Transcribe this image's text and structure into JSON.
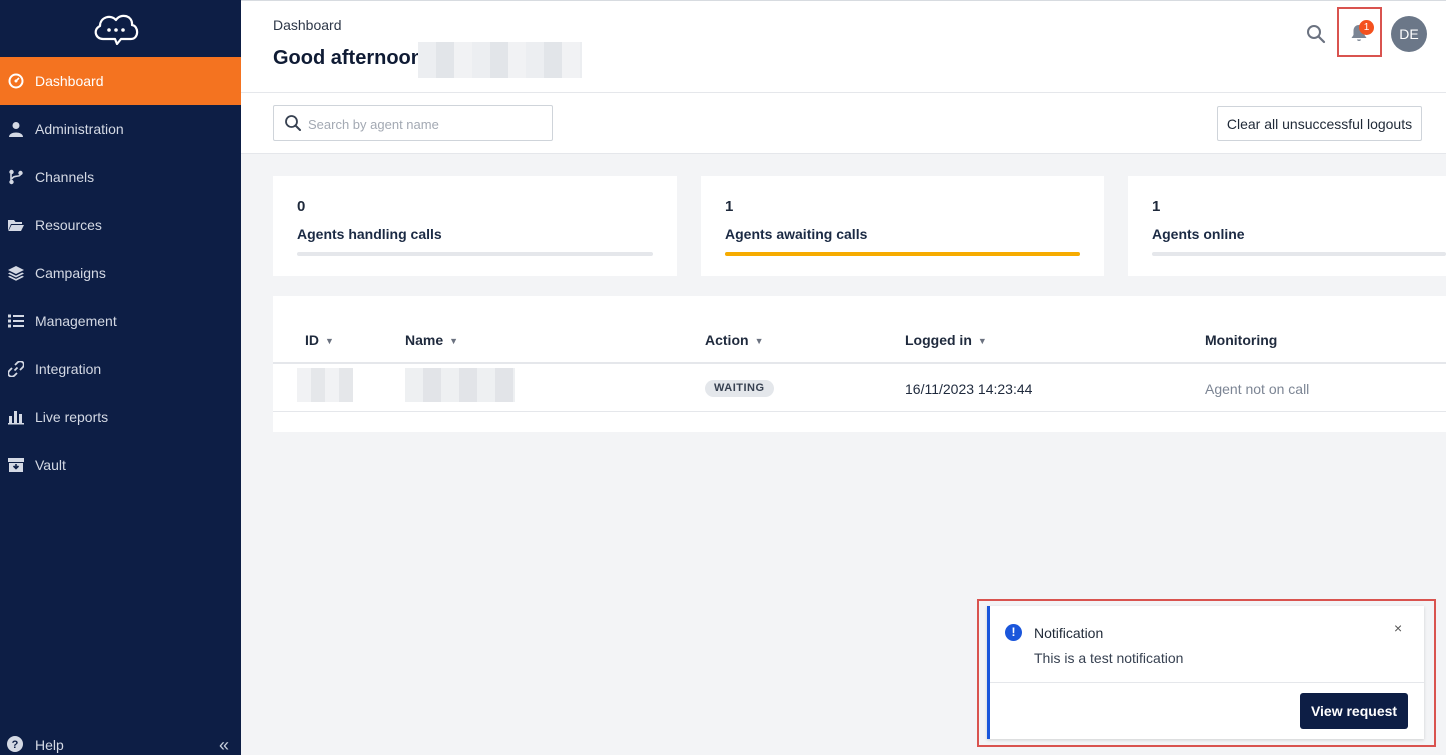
{
  "sidebar": {
    "items": [
      {
        "label": "Dashboard",
        "icon": "dashboard-gauge-icon",
        "active": true
      },
      {
        "label": "Administration",
        "icon": "user-icon"
      },
      {
        "label": "Channels",
        "icon": "branch-icon"
      },
      {
        "label": "Resources",
        "icon": "folder-icon"
      },
      {
        "label": "Campaigns",
        "icon": "layers-icon"
      },
      {
        "label": "Management",
        "icon": "list-icon"
      },
      {
        "label": "Integration",
        "icon": "link-icon"
      },
      {
        "label": "Live reports",
        "icon": "bar-chart-icon"
      },
      {
        "label": "Vault",
        "icon": "archive-icon"
      }
    ],
    "help_label": "Help",
    "collapse_glyph": "«"
  },
  "header": {
    "breadcrumb": "Dashboard",
    "greeting": "Good afternoon,",
    "notification_count": "1",
    "avatar_initials": "DE"
  },
  "toolbar": {
    "search_placeholder": "Search by agent name",
    "clear_button": "Clear all unsuccessful logouts"
  },
  "stats": [
    {
      "count": "0",
      "label": "Agents handling calls",
      "progress": 0
    },
    {
      "count": "1",
      "label": "Agents awaiting calls",
      "progress": 1
    },
    {
      "count": "1",
      "label": "Agents online",
      "progress": 0
    }
  ],
  "table": {
    "columns": [
      "ID",
      "Name",
      "Action",
      "Logged in",
      "Monitoring"
    ],
    "rows": [
      {
        "id": "",
        "name": "",
        "action": "WAITING",
        "logged_in": "16/11/2023 14:23:44",
        "monitoring": "Agent not on call"
      }
    ]
  },
  "notification": {
    "title": "Notification",
    "message": "This is a test notification",
    "close_glyph": "×",
    "button": "View request"
  },
  "colors": {
    "sidebar_bg": "#0d1e45",
    "accent": "#f47320",
    "progress": "#f6ab00",
    "highlight_border": "#d9534f"
  }
}
